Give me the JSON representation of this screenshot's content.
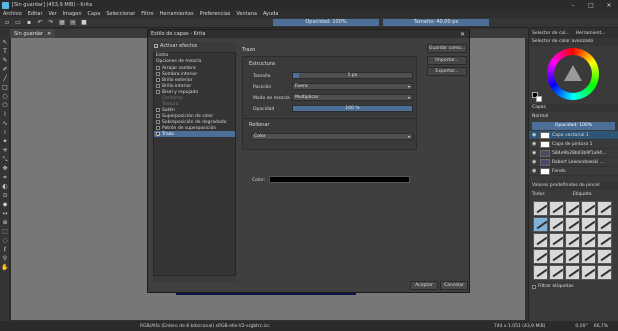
{
  "window": {
    "title": "[Sin guardar] (453,9 MiB) - Krita",
    "controls": [
      "–",
      "□",
      "✕"
    ]
  },
  "menu": [
    "Archivo",
    "Editar",
    "Ver",
    "Imagen",
    "Capa",
    "Seleccionar",
    "Filtro",
    "Herramientas",
    "Preferencias",
    "Ventana",
    "Ayuda"
  ],
  "toolbar": {
    "opacity": "Opacidad: 100%",
    "size": "Tamaño: 40,00 px"
  },
  "document_tab": {
    "label": "Sin guardar",
    "close": "✕"
  },
  "dialog": {
    "title": "Estilo de capas - Krita",
    "close": "✕",
    "activate_effects": "Activar efectos",
    "effects_items": [
      {
        "label": "Estilo",
        "type": "plain"
      },
      {
        "label": "Opciones de mezcla",
        "type": "plain"
      },
      {
        "label": "Arrojar sombra",
        "type": "check",
        "checked": false
      },
      {
        "label": "Sombra interior",
        "type": "check",
        "checked": false
      },
      {
        "label": "Brillo exterior",
        "type": "check",
        "checked": false
      },
      {
        "label": "Brillo interior",
        "type": "check",
        "checked": false
      },
      {
        "label": "Bisel y repujado",
        "type": "check",
        "checked": false
      },
      {
        "label": "Contorno",
        "type": "disabled"
      },
      {
        "label": "Textura",
        "type": "disabled"
      },
      {
        "label": "Satén",
        "type": "check",
        "checked": false
      },
      {
        "label": "Superposición de color",
        "type": "check",
        "checked": false
      },
      {
        "label": "Sobreposición de degradado",
        "type": "check",
        "checked": false
      },
      {
        "label": "Patrón de superposición",
        "type": "check",
        "checked": false
      },
      {
        "label": "Trazo",
        "type": "check",
        "checked": true,
        "selected": true
      }
    ],
    "section": "Trazo",
    "structure": {
      "title": "Estructura",
      "size_label": "Tamaño",
      "size_value": "1 px",
      "size_fraction": 0.05,
      "position_label": "Posición",
      "position_value": "Fuera",
      "blend_label": "Modo de mezcla",
      "blend_value": "Multiplicar",
      "opacity_label": "Opacidad",
      "opacity_value": "100 %",
      "opacity_fraction": 1.0
    },
    "fill": {
      "title": "Rellenar",
      "type_value": "Color",
      "color_label": "Color:",
      "color_hex": "#000000"
    },
    "side_buttons": [
      "Guardar como...",
      "Importar...",
      "Exportar..."
    ],
    "ok": "Aceptar",
    "cancel": "Cancelar"
  },
  "dockers": {
    "tabs": [
      "Selector de col...",
      "Herramient..."
    ],
    "selector_title": "Selector de color avanzado",
    "layers_title": "Capas",
    "blend_mode": "Normal",
    "opacity": "Opacidad: 100%",
    "layers": [
      {
        "name": "Capa vectorial 1",
        "selected": true,
        "dark": false
      },
      {
        "name": "Capa de pintura 1",
        "selected": false,
        "dark": false
      },
      {
        "name": "584e9b28b03b9f1a94...",
        "selected": false,
        "dark": true
      },
      {
        "name": "Robert Lewandowski ...",
        "selected": false,
        "dark": true
      },
      {
        "name": "Fondo",
        "selected": false,
        "dark": false
      }
    ],
    "brushes_title": "Valores predefinidos de pincel",
    "brushes_filter": "Todos",
    "brushes_tag": "Etiqueta",
    "filter_label": "Filtrar etiquetas"
  },
  "status": {
    "colorspace": "RGB/Alfa (Entero de 8 bits/canal)  sRGB-elle-V2-srgbtrc.icc",
    "dimensions": "744 x 1.051 (43,9 MiB)",
    "rotation": "0,00°",
    "zoom": "66,7%"
  }
}
